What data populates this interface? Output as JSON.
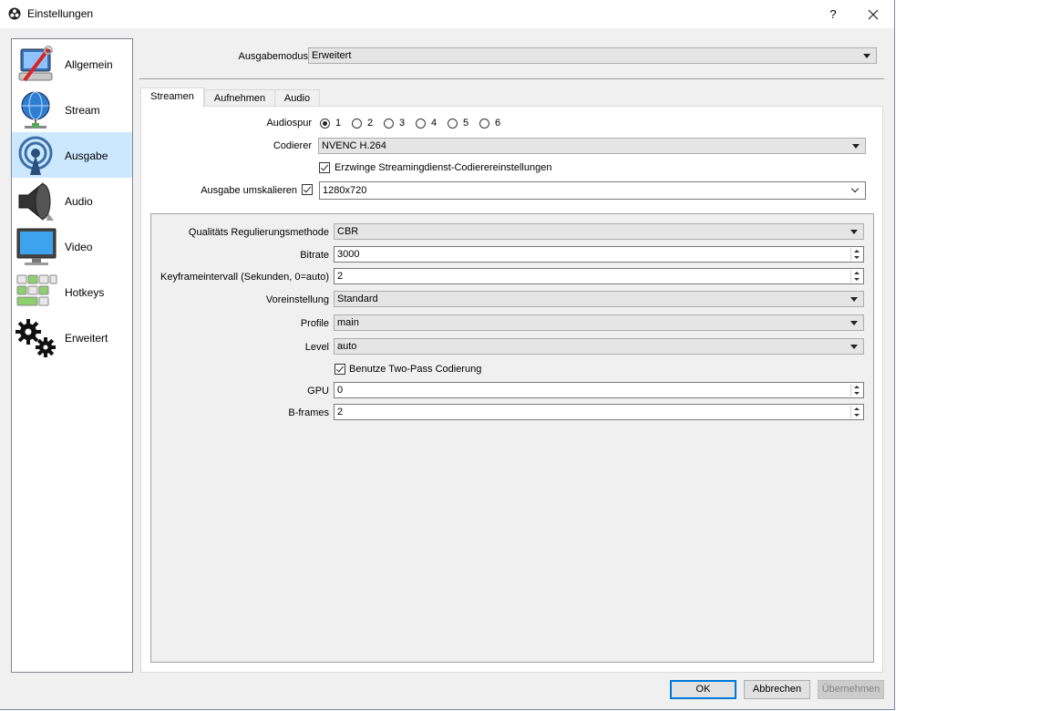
{
  "window": {
    "title": "Einstellungen",
    "help": "?"
  },
  "sidebar": {
    "items": [
      {
        "label": "Allgemein",
        "icon": "computer-wrench-icon"
      },
      {
        "label": "Stream",
        "icon": "globe-network-icon"
      },
      {
        "label": "Ausgabe",
        "icon": "broadcast-antenna-icon"
      },
      {
        "label": "Audio",
        "icon": "speaker-icon"
      },
      {
        "label": "Video",
        "icon": "monitor-icon"
      },
      {
        "label": "Hotkeys",
        "icon": "keyboard-icon"
      },
      {
        "label": "Erweitert",
        "icon": "gears-icon"
      }
    ],
    "selected": "Ausgabe"
  },
  "output_mode": {
    "label": "Ausgabemodus",
    "value": "Erweitert"
  },
  "tabs": [
    {
      "label": "Streamen",
      "active": true
    },
    {
      "label": "Aufnehmen",
      "active": false
    },
    {
      "label": "Audio",
      "active": false
    }
  ],
  "streaming": {
    "audiospur_label": "Audiospur",
    "tracks": [
      "1",
      "2",
      "3",
      "4",
      "5",
      "6"
    ],
    "selected_track": "1",
    "codierer_label": "Codierer",
    "codierer_value": "NVENC H.264",
    "force_settings_label": "Erzwinge Streamingdienst-Codierereinstellungen",
    "force_settings_checked": true,
    "rescale_label": "Ausgabe umskalieren",
    "rescale_checked": true,
    "rescale_value": "1280x720"
  },
  "encoder": {
    "rate_control_label": "Qualitäts Regulierungsmethode",
    "rate_control_value": "CBR",
    "bitrate_label": "Bitrate",
    "bitrate_value": "3000",
    "keyframe_label": "Keyframeintervall (Sekunden, 0=auto)",
    "keyframe_value": "2",
    "preset_label": "Voreinstellung",
    "preset_value": "Standard",
    "profile_label": "Profile",
    "profile_value": "main",
    "level_label": "Level",
    "level_value": "auto",
    "two_pass_label": "Benutze Two-Pass Codierung",
    "two_pass_checked": true,
    "gpu_label": "GPU",
    "gpu_value": "0",
    "bframes_label": "B-frames",
    "bframes_value": "2"
  },
  "buttons": {
    "ok": "OK",
    "cancel": "Abbrechen",
    "apply": "Übernehmen"
  },
  "colors": {
    "selected_bg": "#cce8ff",
    "default_button_border": "#0078d7"
  }
}
